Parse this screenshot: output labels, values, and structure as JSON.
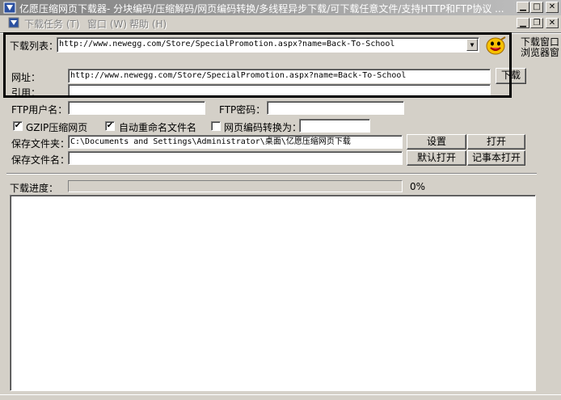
{
  "window": {
    "title": "亿愿压缩网页下载器- 分块编码/压缩解码/网页编码转换/多线程异步下载/可下载任意文件/支持HTTP和FTP协议 ..."
  },
  "menu": {
    "items": [
      "下载任务 (T)",
      "窗口 (W)",
      "帮助 (H)"
    ]
  },
  "download_list": {
    "label": "下载列表：",
    "value": "http://www.newegg.com/Store/SpecialPromotion.aspx?name=Back-To-School"
  },
  "side_labels": {
    "line1": "下载窗口",
    "line2": "浏览器窗"
  },
  "url": {
    "label": "网址：",
    "value": "http://www.newegg.com/Store/SpecialPromotion.aspx?name=Back-To-School",
    "download_button": "下载"
  },
  "referer": {
    "label": "引用：",
    "value": ""
  },
  "ftp": {
    "user_label": "FTP用户名：",
    "password_label": "FTP密码："
  },
  "options": {
    "gzip": {
      "label": "GZIP压缩网页",
      "checked": true
    },
    "auto_rename": {
      "label": "自动重命名文件名",
      "checked": true
    },
    "encoding_convert": {
      "label": "网页编码转换为：",
      "checked": false,
      "value": ""
    }
  },
  "save_folder": {
    "label": "保存文件夹：",
    "value": "C:\\Documents and Settings\\Administrator\\桌面\\亿愿压缩网页下载"
  },
  "save_name": {
    "label": "保存文件名：",
    "value": ""
  },
  "buttons": {
    "settings": "设置",
    "open": "打开",
    "default_open": "默认打开",
    "notepad_open": "记事本打开"
  },
  "progress": {
    "label": "下载进度：",
    "percent_text": "0%",
    "fraction": 0
  },
  "check_mark": "✔"
}
